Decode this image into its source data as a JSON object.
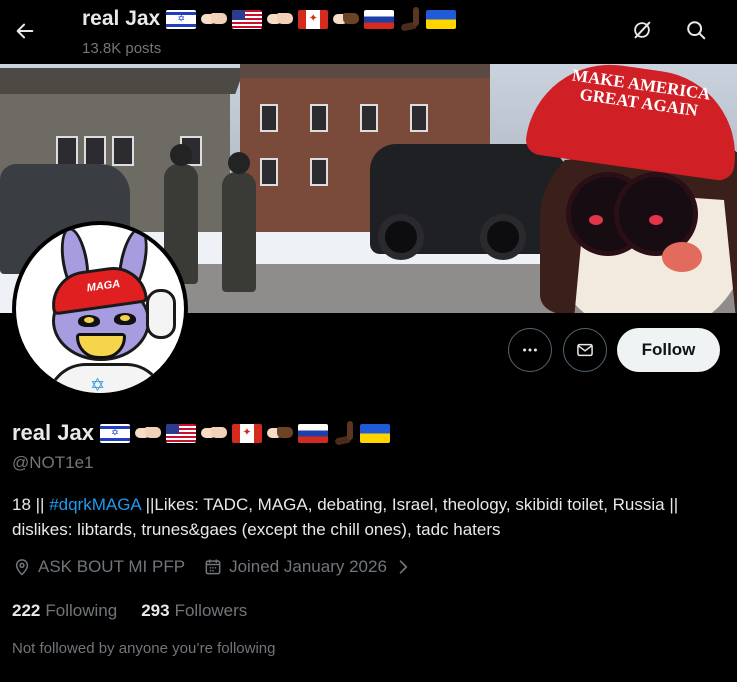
{
  "header": {
    "name": "real Jax",
    "posts": "13.8K posts"
  },
  "banner": {
    "cap_text": "MAKE AMERICA GREAT AGAIN"
  },
  "avatar": {
    "cap_text": "MAGA"
  },
  "profile": {
    "name": "real Jax",
    "handle": "@NOT1e1",
    "bio_prefix": "18 || ",
    "bio_hashtag": "#dqrkMAGA",
    "bio_rest": " ||Likes: TADC, MAGA, debating, Israel, theology, skibidi toilet, Russia  || dislikes: libtards, trunes&gaes (except the chill ones), tadc haters",
    "location": "ASK BOUT MI PFP",
    "joined": "Joined January 2026",
    "following_count": "222",
    "following_label": "Following",
    "followers_count": "293",
    "followers_label": "Followers",
    "not_followed": "Not followed by anyone you’re following"
  },
  "actions": {
    "follow_label": "Follow"
  },
  "icons": {
    "back": "arrow-left-icon",
    "grok": "grok-icon",
    "search": "search-icon",
    "more": "more-icon",
    "message": "mail-icon",
    "location": "location-icon",
    "calendar": "calendar-icon",
    "chevron": "chevron-right-icon"
  },
  "colors": {
    "background": "#000000",
    "text_primary": "#e7e9ea",
    "text_secondary": "#71767b",
    "link": "#1d9bf0",
    "follow_bg": "#eff3f4"
  }
}
